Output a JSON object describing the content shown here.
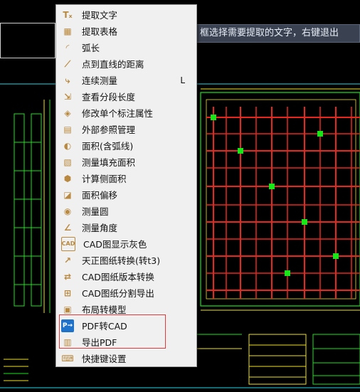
{
  "status_tip": "框选择需要提取的文字，右键退出",
  "menu": {
    "items": [
      {
        "label": "提取文字",
        "icon": "text-extract-icon",
        "glyph": "Tₓ",
        "style": "tanline",
        "shortcut": ""
      },
      {
        "label": "提取表格",
        "icon": "table-extract-icon",
        "glyph": "▦",
        "style": "tanline",
        "shortcut": ""
      },
      {
        "label": "弧长",
        "icon": "arc-length-icon",
        "glyph": "◜",
        "style": "tanline",
        "shortcut": ""
      },
      {
        "label": "点到直线的距离",
        "icon": "point-line-distance-icon",
        "glyph": "⟋",
        "style": "tanline",
        "shortcut": ""
      },
      {
        "label": "连续测量",
        "icon": "continuous-measure-icon",
        "glyph": "⤷",
        "style": "tanline",
        "shortcut": "L"
      },
      {
        "label": "查看分段长度",
        "icon": "segment-length-icon",
        "glyph": "⇲",
        "style": "tanline",
        "shortcut": ""
      },
      {
        "label": "修改单个标注属性",
        "icon": "dimension-edit-icon",
        "glyph": "◈",
        "style": "tanline",
        "shortcut": ""
      },
      {
        "label": "外部参照管理",
        "icon": "xref-manage-icon",
        "glyph": "▤",
        "style": "tanline",
        "shortcut": ""
      },
      {
        "label": "面积(含弧线)",
        "icon": "area-arc-icon",
        "glyph": "◐",
        "style": "tanline",
        "shortcut": ""
      },
      {
        "label": "测量填充面积",
        "icon": "hatch-area-icon",
        "glyph": "▧",
        "style": "tanline",
        "shortcut": ""
      },
      {
        "label": "计算侧面积",
        "icon": "side-area-icon",
        "glyph": "⬢",
        "style": "tanline",
        "shortcut": ""
      },
      {
        "label": "面积偏移",
        "icon": "area-offset-icon",
        "glyph": "◪",
        "style": "tanline",
        "shortcut": ""
      },
      {
        "label": "测量圆",
        "icon": "measure-circle-icon",
        "glyph": "◉",
        "style": "tanline",
        "shortcut": ""
      },
      {
        "label": "测量角度",
        "icon": "measure-angle-icon",
        "glyph": "∠",
        "style": "tanline",
        "shortcut": ""
      },
      {
        "label": "CAD图显示灰色",
        "icon": "gray-display-icon",
        "glyph": "CAD",
        "style": "tanline",
        "shortcut": ""
      },
      {
        "label": "天正图纸转换(转t3)",
        "icon": "tangent-convert-icon",
        "glyph": "↗",
        "style": "tanline",
        "shortcut": ""
      },
      {
        "label": "CAD图纸版本转换",
        "icon": "version-convert-icon",
        "glyph": "⇄",
        "style": "tanline",
        "shortcut": ""
      },
      {
        "label": "CAD图纸分割导出",
        "icon": "split-export-icon",
        "glyph": "⊞",
        "style": "tanline",
        "shortcut": ""
      },
      {
        "label": "布局转模型",
        "icon": "layout-to-model-icon",
        "glyph": "▣",
        "style": "tanline",
        "shortcut": ""
      },
      {
        "label": "PDF转CAD",
        "icon": "pdf-to-cad-icon",
        "glyph": "P→",
        "style": "blue",
        "shortcut": ""
      },
      {
        "label": "导出PDF",
        "icon": "export-pdf-icon",
        "glyph": "▥",
        "style": "tanline",
        "shortcut": ""
      },
      {
        "label": "快捷键设置",
        "icon": "shortcut-settings-icon",
        "glyph": "⌨",
        "style": "tanline",
        "shortcut": ""
      }
    ]
  },
  "colors": {
    "cad_green": "#19e619",
    "cad_red": "#e8261c",
    "cad_yellow": "#f2e21a",
    "cad_cyan": "#20d8e8",
    "highlight_red": "#e23a3a"
  }
}
